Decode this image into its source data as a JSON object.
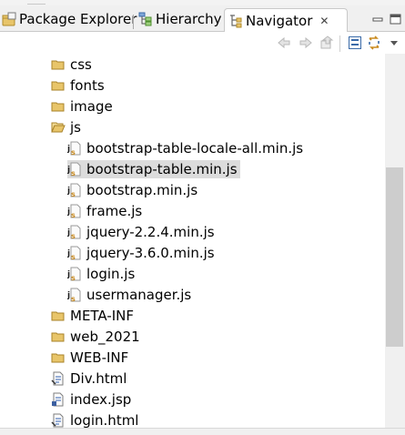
{
  "tabs": [
    {
      "label": "Package Explorer",
      "icon": "package-explorer-icon",
      "active": false
    },
    {
      "label": "Hierarchy",
      "icon": "hierarchy-icon",
      "active": false
    },
    {
      "label": "Navigator",
      "icon": "navigator-icon",
      "active": true
    }
  ],
  "navigator_close": "✕",
  "toolbar_actions": [
    "back",
    "forward",
    "up",
    "collapse-all",
    "link-with-editor",
    "view-menu"
  ],
  "tree": [
    {
      "label": "css",
      "kind": "folder",
      "open": false,
      "selected": false
    },
    {
      "label": "fonts",
      "kind": "folder",
      "open": false,
      "selected": false
    },
    {
      "label": "image",
      "kind": "folder",
      "open": false,
      "selected": false
    },
    {
      "label": "js",
      "kind": "folder",
      "open": true,
      "selected": false
    },
    {
      "label": "bootstrap-table-locale-all.min.js",
      "kind": "js",
      "selected": false
    },
    {
      "label": "bootstrap-table.min.js",
      "kind": "js",
      "selected": true
    },
    {
      "label": "bootstrap.min.js",
      "kind": "js",
      "selected": false
    },
    {
      "label": "frame.js",
      "kind": "js",
      "selected": false
    },
    {
      "label": "jquery-2.2.4.min.js",
      "kind": "js",
      "selected": false
    },
    {
      "label": "jquery-3.6.0.min.js",
      "kind": "js",
      "selected": false
    },
    {
      "label": "login.js",
      "kind": "js",
      "selected": false
    },
    {
      "label": "usermanager.js",
      "kind": "js",
      "selected": false
    },
    {
      "label": "META-INF",
      "kind": "folder",
      "open": false,
      "selected": false
    },
    {
      "label": "web_2021",
      "kind": "folder",
      "open": false,
      "selected": false
    },
    {
      "label": "WEB-INF",
      "kind": "folder",
      "open": false,
      "selected": false
    },
    {
      "label": "Div.html",
      "kind": "html",
      "selected": false
    },
    {
      "label": "index.jsp",
      "kind": "jsp",
      "selected": false
    },
    {
      "label": "login.html",
      "kind": "html",
      "selected": false
    }
  ],
  "colors": {
    "folder": "#e8c56a",
    "js_badge": "#5b7fbf",
    "selection": "#dcdcdc",
    "accent": "#1f6fd1"
  }
}
